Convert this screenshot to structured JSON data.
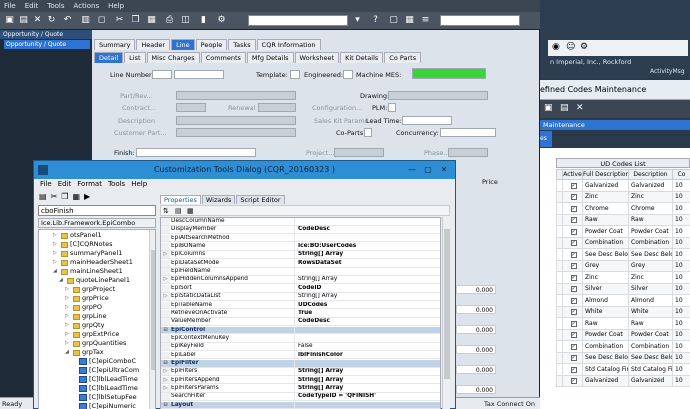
{
  "main": {
    "menu": [
      "File",
      "Edit",
      "Tools",
      "Actions",
      "Help"
    ],
    "left_tree": {
      "header": "Opportunity / Quote",
      "selected": "Opportunity / Quote"
    },
    "tabs_row1": [
      "Summary",
      "Header",
      "Line",
      "People",
      "Tasks",
      "CQR Information"
    ],
    "tabs_row2": [
      "Detail",
      "List",
      "Misc Charges",
      "Comments",
      "Mfg Details",
      "Worksheet",
      "Kit Details",
      "Co Parts"
    ],
    "labels": {
      "line_number": "Line Number:",
      "template": "Template:",
      "engineered": "Engineered:",
      "machine_mes": "Machine MES:",
      "part_rev": "Part/Rev...",
      "drawing": "Drawing:",
      "contract": "Contract...",
      "renewal": "Renewal",
      "configuration": "Configuration...",
      "plm": "PLM:",
      "description": "Description",
      "sales_kit": "Sales Kit Params",
      "lead_time": "Lead Time:",
      "customer_part": "Customer Part...",
      "co_parts": "Co-Parts:",
      "concurrency": "Concurrency:",
      "finish": "Finish:",
      "project": "Project...",
      "phase": "Phase...",
      "price": "Price"
    },
    "right_values": [
      "0.000",
      "0.000",
      "0.000",
      "0.000",
      "0.000",
      "0.000"
    ],
    "status_left": "Ready",
    "status_right": "Tax Connect On"
  },
  "right_window": {
    "company": "n Imperial, Inc., Rockford",
    "activity": "ActivityMsg",
    "title": "efined Codes Maintenance",
    "section": "Maintenance",
    "tab": "es",
    "list_title": "UD Codes List",
    "columns": [
      "",
      "Active",
      "Full Description",
      "Description",
      "Co"
    ],
    "rows": [
      {
        "full": "Galvanized",
        "desc": "Galvanized",
        "co": "10"
      },
      {
        "full": "Zinc",
        "desc": "Zinc",
        "co": "10"
      },
      {
        "full": "Chrome",
        "desc": "Chrome",
        "co": "10"
      },
      {
        "full": "Raw",
        "desc": "Raw",
        "co": "10"
      },
      {
        "full": "Powder Coat",
        "desc": "Powder Coat",
        "co": "10"
      },
      {
        "full": "Combination",
        "desc": "Combination",
        "co": "10"
      },
      {
        "full": "See Desc Below",
        "desc": "See Desc Below",
        "co": "10"
      },
      {
        "full": "Grey",
        "desc": "Grey",
        "co": "10"
      },
      {
        "full": "Zinc",
        "desc": "Zinc",
        "co": "10"
      },
      {
        "full": "Silver",
        "desc": "Silver",
        "co": "10"
      },
      {
        "full": "Almond",
        "desc": "Almond",
        "co": "10"
      },
      {
        "full": "White",
        "desc": "White",
        "co": "10"
      },
      {
        "full": "Raw",
        "desc": "Raw",
        "co": "10"
      },
      {
        "full": "Powder Coat",
        "desc": "Powder Coat",
        "co": "10"
      },
      {
        "full": "Combination",
        "desc": "Combination",
        "co": "10"
      },
      {
        "full": "See Desc Below",
        "desc": "See Desc Below",
        "co": "10"
      },
      {
        "full": "Std Catalog Finis",
        "desc": "Std Catalog Finis",
        "co": "10"
      },
      {
        "full": "Galvanized",
        "desc": "Galvanized",
        "co": "10"
      }
    ]
  },
  "dialog": {
    "title": "Customization Tools Dialog  (CQR_20160323 )",
    "menu": [
      "File",
      "Edit",
      "Format",
      "Tools",
      "Help"
    ],
    "control_name": "cboFinish",
    "control_type": "Ice.Lib.Framework.EpiCombo",
    "tree": [
      {
        "label": "otsPanel1",
        "indent": 2,
        "type": "folder"
      },
      {
        "label": "[C]CQRNotes",
        "indent": 2,
        "type": "folder"
      },
      {
        "label": "summaryPanel1",
        "indent": 2,
        "type": "folder"
      },
      {
        "label": "mainHeaderSheet1",
        "indent": 2,
        "type": "folder"
      },
      {
        "label": "mainLineSheet1",
        "indent": 2,
        "type": "folder"
      },
      {
        "label": "quoteLinePanel1",
        "indent": 3,
        "type": "folder"
      },
      {
        "label": "grpProject",
        "indent": 4,
        "type": "folder"
      },
      {
        "label": "grpPrice",
        "indent": 4,
        "type": "folder"
      },
      {
        "label": "grpPO",
        "indent": 4,
        "type": "folder"
      },
      {
        "label": "grpLine",
        "indent": 4,
        "type": "folder"
      },
      {
        "label": "grpQty",
        "indent": 4,
        "type": "folder"
      },
      {
        "label": "grpExtPrice",
        "indent": 4,
        "type": "folder"
      },
      {
        "label": "grpQuantities",
        "indent": 4,
        "type": "folder"
      },
      {
        "label": "grpTax",
        "indent": 4,
        "type": "folder"
      },
      {
        "label": "[C]epiComboC",
        "indent": 5,
        "type": "ctrl"
      },
      {
        "label": "[C]epiUltraCom",
        "indent": 5,
        "type": "ctrl"
      },
      {
        "label": "[C]lblLeadTime",
        "indent": 5,
        "type": "ctrl"
      },
      {
        "label": "[C]lblLeadTime",
        "indent": 5,
        "type": "ctrl"
      },
      {
        "label": "[C]lblSetupFee",
        "indent": 5,
        "type": "ctrl"
      },
      {
        "label": "[C]epiNumeric",
        "indent": 5,
        "type": "ctrl"
      }
    ],
    "tabs": [
      "Properties",
      "Wizards",
      "Script Editor"
    ],
    "properties": [
      {
        "name": "DescColumnName",
        "value": "",
        "bold": false,
        "exp": false,
        "cat": false
      },
      {
        "name": "DisplayMember",
        "value": "CodeDesc",
        "bold": true,
        "exp": false,
        "cat": false
      },
      {
        "name": "EpiAltSearchMethod",
        "value": "",
        "bold": false,
        "exp": false,
        "cat": false
      },
      {
        "name": "EpiBOName",
        "value": "Ice:BO:UserCodes",
        "bold": true,
        "exp": false,
        "cat": false
      },
      {
        "name": "EpiColumns",
        "value": "String[] Array",
        "bold": true,
        "exp": true,
        "cat": false
      },
      {
        "name": "EpiDataSetMode",
        "value": "RowsDataSet",
        "bold": true,
        "exp": false,
        "cat": false
      },
      {
        "name": "EpiFieldName",
        "value": "",
        "bold": false,
        "exp": false,
        "cat": false
      },
      {
        "name": "EpiHiddenColumnsAppend",
        "value": "String[] Array",
        "bold": false,
        "exp": true,
        "cat": false
      },
      {
        "name": "EpiSort",
        "value": "CodeID",
        "bold": true,
        "exp": false,
        "cat": false
      },
      {
        "name": "EpiStaticDataList",
        "value": "String[] Array",
        "bold": false,
        "exp": true,
        "cat": false
      },
      {
        "name": "EpiTableName",
        "value": "UDCodes",
        "bold": true,
        "exp": false,
        "cat": false
      },
      {
        "name": "RetrieveOnActivate",
        "value": "True",
        "bold": true,
        "exp": false,
        "cat": false
      },
      {
        "name": "ValueMember",
        "value": "CodeDesc",
        "bold": true,
        "exp": false,
        "cat": false
      },
      {
        "name": "EpiControl",
        "value": "",
        "bold": false,
        "exp": false,
        "cat": true
      },
      {
        "name": "EpiContextMenuKey",
        "value": "",
        "bold": false,
        "exp": false,
        "cat": false
      },
      {
        "name": "EpiKeyField",
        "value": "False",
        "bold": false,
        "exp": false,
        "cat": false
      },
      {
        "name": "EpiLabel",
        "value": "lblFinishColor",
        "bold": true,
        "exp": false,
        "cat": false
      },
      {
        "name": "EpiFilter",
        "value": "",
        "bold": false,
        "exp": false,
        "cat": true
      },
      {
        "name": "EpiFilters",
        "value": "String[] Array",
        "bold": true,
        "exp": true,
        "cat": false
      },
      {
        "name": "EpiFiltersAppend",
        "value": "String[] Array",
        "bold": true,
        "exp": true,
        "cat": false
      },
      {
        "name": "EpiFiltersParams",
        "value": "String[] Array",
        "bold": true,
        "exp": true,
        "cat": false
      },
      {
        "name": "SearchFilter",
        "value": "CodeTypeID = 'QFINISH'",
        "bold": true,
        "exp": false,
        "cat": false
      },
      {
        "name": "Layout",
        "value": "",
        "bold": false,
        "exp": false,
        "cat": true
      }
    ]
  }
}
